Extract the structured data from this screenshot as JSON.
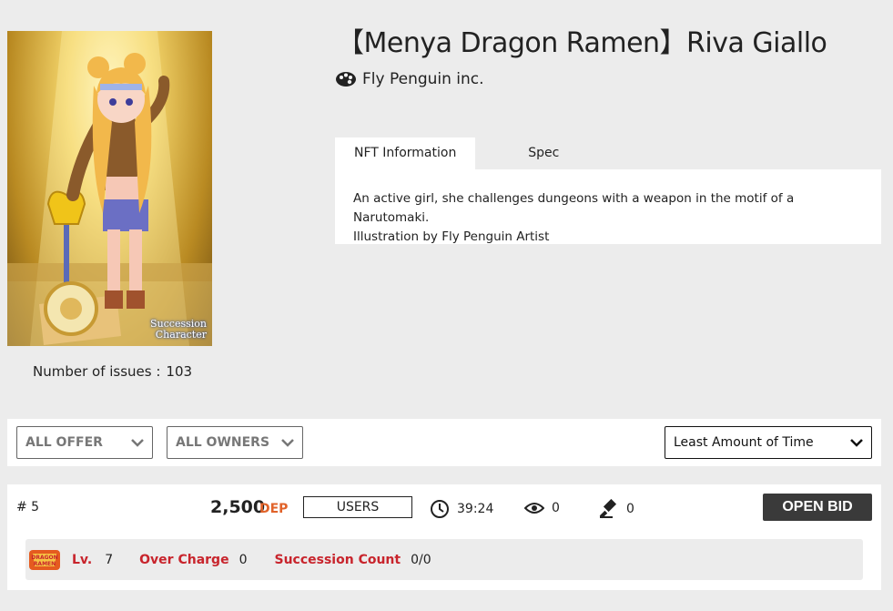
{
  "nft": {
    "title": "【Menya Dragon Ramen】Riva Giallo",
    "creator": "Fly Penguin inc.",
    "creator_icon": "palette-icon",
    "image_badge": "Succession Character",
    "issues_label": "Number of issues :",
    "issues_value": "103"
  },
  "tabs": {
    "nft_information": "NFT Information",
    "spec": "Spec",
    "active": "nft_information"
  },
  "description": {
    "line1": "An active girl, she challenges dungeons with a weapon in the motif of a Narutomaki.",
    "line2": "Illustration by Fly Penguin Artist"
  },
  "filters": {
    "offer": "ALL OFFER",
    "owners": "ALL OWNERS",
    "sort": "Least Amount of Time"
  },
  "listing": {
    "item_number": "# 5",
    "price": "2,500",
    "currency": "DEP",
    "users_label": "USERS",
    "time_left": "39:24",
    "views": "0",
    "bids": "0",
    "open_bid_label": "OPEN BID",
    "logo_text": "DRAGON RAMEN",
    "level_label": "Lv.",
    "level_value": "7",
    "over_charge_label": "Over Charge",
    "over_charge_value": "0",
    "succession_label": "Succession Count",
    "succession_value": "0/0"
  },
  "colors": {
    "accent_orange": "#e1632a",
    "meta_red": "#c8242c",
    "button_dark": "#3a3a3a",
    "background": "#ececec"
  }
}
